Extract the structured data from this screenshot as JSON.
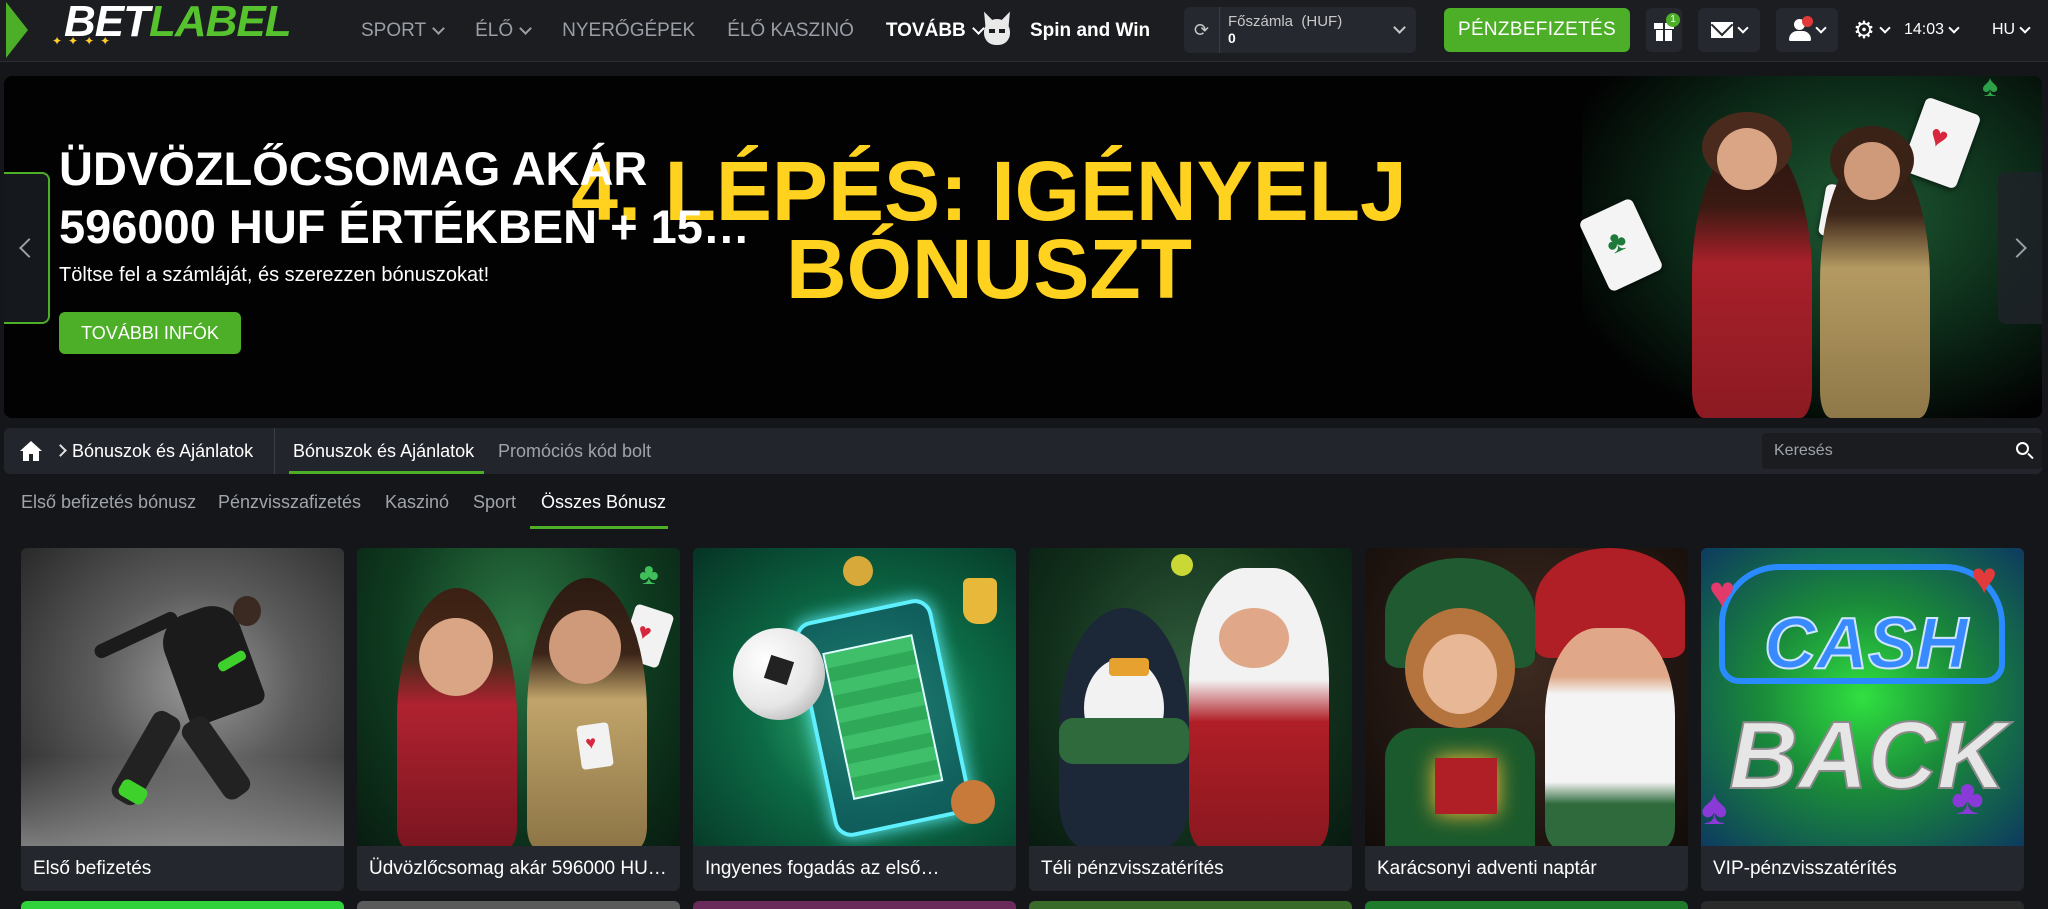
{
  "header": {
    "logo_bet": "BET",
    "logo_label": "LABEL",
    "nav": [
      {
        "label": "SPORT",
        "has_dropdown": true
      },
      {
        "label": "ÉLŐ",
        "has_dropdown": true
      },
      {
        "label": "NYERŐGÉPEK",
        "has_dropdown": false
      },
      {
        "label": "ÉLŐ KASZINÓ",
        "has_dropdown": false
      },
      {
        "label": "TOVÁBB",
        "has_dropdown": true
      }
    ],
    "spin_label": "Spin and Win",
    "account": {
      "name": "Főszámla",
      "currency": "(HUF)",
      "balance": "0"
    },
    "deposit_label": "PÉNZBEFIZETÉS",
    "gift_badge": "1",
    "time": "14:03",
    "lang": "HU"
  },
  "hero": {
    "title": "ÜDVÖZLŐCSOMAG AKÁR 596000 HUF ÉRTÉKBEN + 15…",
    "subtitle": "Töltse fel a számláját, és szerezzen bónuszokat!",
    "cta": "TOVÁBBI INFÓK",
    "step_title": "4. LÉPÉS: IGÉNYELJ BÓNUSZT"
  },
  "breadcrumb": {
    "current": "Bónuszok és Ajánlatok",
    "tabs": [
      "Bónuszok és Ajánlatok",
      "Promóciós kód bolt"
    ],
    "search_placeholder": "Keresés"
  },
  "categories": {
    "items": [
      "Első befizetés bónusz",
      "Pénzvisszafizetés",
      "Kaszinó",
      "Sport",
      "Összes Bónusz"
    ],
    "active": "Összes Bónusz"
  },
  "bonuses": [
    {
      "title": "Első befizetés"
    },
    {
      "title": "Üdvözlőcsomag akár 596000 HU…"
    },
    {
      "title": "Ingyenes fogadás az első…"
    },
    {
      "title": "Téli pénzvisszatérítés"
    },
    {
      "title": "Karácsonyi adventi naptár"
    },
    {
      "title": "VIP-pénzvisszatérítés"
    }
  ],
  "card_art": {
    "cashback_line1": "CASH",
    "cashback_line2": "BACK"
  },
  "colors": {
    "accent_green": "#4caf27",
    "step_yellow": "#ffd21f",
    "background": "#14161a"
  }
}
